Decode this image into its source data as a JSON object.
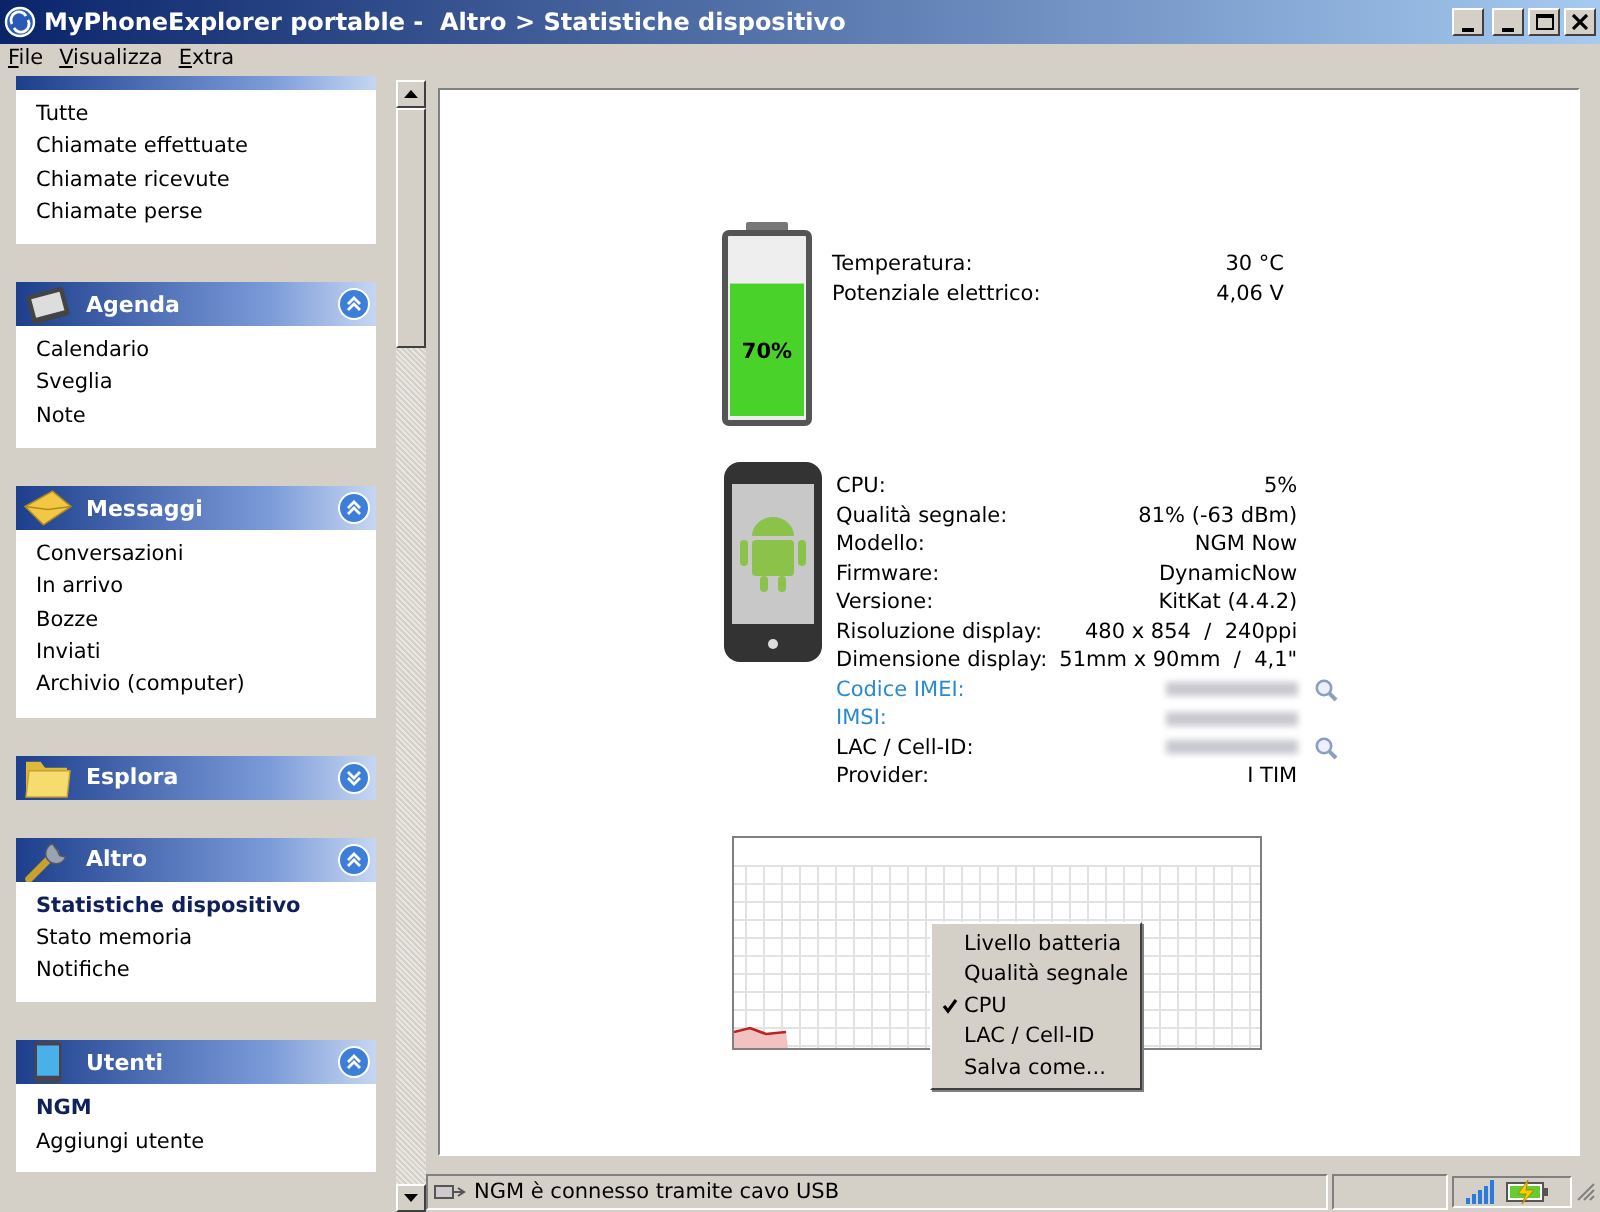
{
  "window": {
    "title": "MyPhoneExplorer portable -  Altro > Statistiche dispositivo"
  },
  "menu": [
    {
      "label": "File"
    },
    {
      "label": "Visualizza"
    },
    {
      "label": "Extra"
    }
  ],
  "sidebar": {
    "groups": [
      {
        "items": [
          {
            "label": "Tutte",
            "selected": false
          },
          {
            "label": "Chiamate effettuate",
            "selected": false
          },
          {
            "label": "Chiamate ricevute",
            "selected": false
          },
          {
            "label": "Chiamate perse",
            "selected": false
          }
        ]
      },
      {
        "title": "Agenda",
        "expanded": true,
        "items": [
          {
            "label": "Calendario",
            "selected": false
          },
          {
            "label": "Sveglia",
            "selected": false
          },
          {
            "label": "Note",
            "selected": false
          }
        ]
      },
      {
        "title": "Messaggi",
        "expanded": true,
        "items": [
          {
            "label": "Conversazioni",
            "selected": false
          },
          {
            "label": "In arrivo",
            "selected": false
          },
          {
            "label": "Bozze",
            "selected": false
          },
          {
            "label": "Inviati",
            "selected": false
          },
          {
            "label": "Archivio (computer)",
            "selected": false
          }
        ]
      },
      {
        "title": "Esplora",
        "expanded": false
      },
      {
        "title": "Altro",
        "expanded": true,
        "items": [
          {
            "label": "Statistiche dispositivo",
            "selected": true
          },
          {
            "label": "Stato memoria",
            "selected": false
          },
          {
            "label": "Notifiche",
            "selected": false
          }
        ]
      },
      {
        "title": "Utenti",
        "expanded": true,
        "items": [
          {
            "label": "NGM",
            "selected": true
          },
          {
            "label": "Aggiungi utente",
            "selected": false
          }
        ]
      }
    ]
  },
  "battery": {
    "level": 0.7,
    "label": "70%",
    "rows": [
      {
        "label": "Temperatura:",
        "value": "30 °C"
      },
      {
        "label": "Potenziale elettrico:",
        "value": "4,06 V"
      }
    ]
  },
  "device": {
    "rows": [
      {
        "label": "CPU:",
        "value": "5%"
      },
      {
        "label": "Qualità segnale:",
        "value": "81% (-63 dBm)"
      },
      {
        "label": "Modello:",
        "value": "NGM Now"
      },
      {
        "label": "Firmware:",
        "value": "DynamicNow"
      },
      {
        "label": "Versione:",
        "value": "KitKat (4.4.2)"
      },
      {
        "label": "Risoluzione display:",
        "value": "480 x 854  /  240ppi"
      },
      {
        "label": "Dimensione display:",
        "value": "51mm x 90mm  /  4,1\""
      },
      {
        "label": "Codice IMEI:",
        "link": true,
        "redacted": true,
        "lookup": true
      },
      {
        "label": "IMSI:",
        "link": true,
        "redacted": true,
        "lookup": false
      },
      {
        "label": "LAC / Cell-ID:",
        "link": false,
        "redacted": true,
        "lookup": true
      },
      {
        "label": "Provider:",
        "value": "I TIM"
      }
    ]
  },
  "context_menu": [
    {
      "label": "Livello batteria",
      "checked": false
    },
    {
      "label": "Qualità segnale",
      "checked": false
    },
    {
      "label": "CPU",
      "checked": true
    },
    {
      "label": "LAC / Cell-ID",
      "checked": false
    },
    {
      "label": "Salva come...",
      "checked": false
    }
  ],
  "status_bar": {
    "text": "NGM è connesso tramite cavo USB"
  }
}
